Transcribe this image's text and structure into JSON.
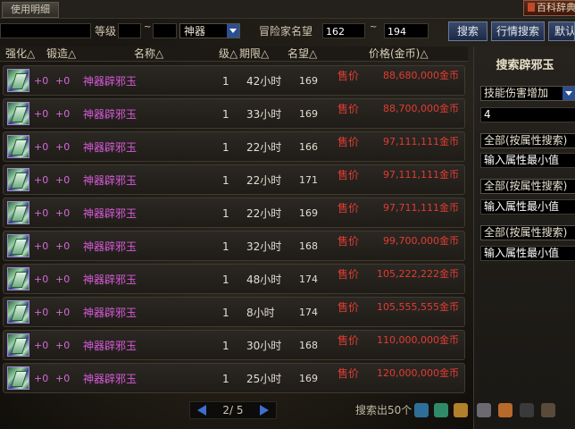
{
  "topbar": {
    "usage_tab": "使用明细",
    "encyclopedia": "百科辞典"
  },
  "search": {
    "name_value": "",
    "level_label": "等级",
    "level_from": "",
    "level_sep": "~",
    "level_to": "",
    "rarity_selected": "神器",
    "fame_label": "冒险家名望",
    "fame_min": "162",
    "fame_sep": "~",
    "fame_max": "194",
    "search_button": "搜索",
    "market_button": "行情搜索",
    "default_button": "默认"
  },
  "table": {
    "headers": {
      "enhance": "强化△",
      "forge": "锻造△",
      "name": "名称△",
      "level": "级△",
      "period": "期限△",
      "fame": "名望△",
      "price": "价格(金币)△"
    },
    "rows": [
      {
        "enhance": "+0",
        "forge": "+0",
        "name": "神器辟邪玉",
        "level": "1",
        "period": "42小时",
        "fame": "169",
        "sell_label": "售价",
        "price": "88,680,000金币"
      },
      {
        "enhance": "+0",
        "forge": "+0",
        "name": "神器辟邪玉",
        "level": "1",
        "period": "33小时",
        "fame": "169",
        "sell_label": "售价",
        "price": "88,700,000金币"
      },
      {
        "enhance": "+0",
        "forge": "+0",
        "name": "神器辟邪玉",
        "level": "1",
        "period": "22小时",
        "fame": "166",
        "sell_label": "售价",
        "price": "97,111,111金币"
      },
      {
        "enhance": "+0",
        "forge": "+0",
        "name": "神器辟邪玉",
        "level": "1",
        "period": "22小时",
        "fame": "171",
        "sell_label": "售价",
        "price": "97,111,111金币"
      },
      {
        "enhance": "+0",
        "forge": "+0",
        "name": "神器辟邪玉",
        "level": "1",
        "period": "22小时",
        "fame": "169",
        "sell_label": "售价",
        "price": "97,711,111金币"
      },
      {
        "enhance": "+0",
        "forge": "+0",
        "name": "神器辟邪玉",
        "level": "1",
        "period": "32小时",
        "fame": "168",
        "sell_label": "售价",
        "price": "99,700,000金币"
      },
      {
        "enhance": "+0",
        "forge": "+0",
        "name": "神器辟邪玉",
        "level": "1",
        "period": "48小时",
        "fame": "174",
        "sell_label": "售价",
        "price": "105,222,222金币"
      },
      {
        "enhance": "+0",
        "forge": "+0",
        "name": "神器辟邪玉",
        "level": "1",
        "period": "8小时",
        "fame": "174",
        "sell_label": "售价",
        "price": "105,555,555金币"
      },
      {
        "enhance": "+0",
        "forge": "+0",
        "name": "神器辟邪玉",
        "level": "1",
        "period": "30小时",
        "fame": "168",
        "sell_label": "售价",
        "price": "110,000,000金币"
      },
      {
        "enhance": "+0",
        "forge": "+0",
        "name": "神器辟邪玉",
        "level": "1",
        "period": "25小时",
        "fame": "169",
        "sell_label": "售价",
        "price": "120,000,000金币"
      }
    ]
  },
  "right_panel": {
    "title": "搜索辟邪玉",
    "skill_select": "技能伤害增加",
    "skill_value": "4",
    "attr1_select": "全部(按属性搜索)",
    "attr1_input": "输入属性最小值",
    "attr2_select": "全部(按属性搜索)",
    "attr2_input": "输入属性最小值",
    "attr3_select": "全部(按属性搜索)",
    "attr3_input": "输入属性最小值"
  },
  "footer": {
    "page_text": "2/ 5",
    "result_count": "搜索出50个"
  },
  "colors": {
    "price_red": "#e23c32",
    "item_name_purple": "#d85ad8",
    "button_blue": "#2c4f8f"
  },
  "icons": {
    "item": "jade-talisman-icon",
    "prev": "prev-page-icon",
    "next": "next-page-icon"
  }
}
